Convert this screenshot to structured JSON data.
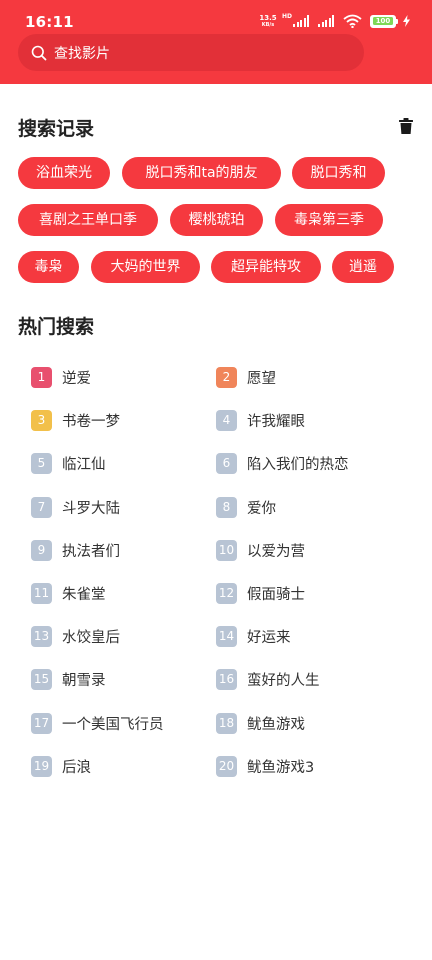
{
  "status_bar": {
    "time": "16:11",
    "net_speed_value": "13.5",
    "net_speed_unit": "KB/s",
    "sim1_tag": "HD",
    "battery": "100"
  },
  "search": {
    "placeholder": "查找影片"
  },
  "history": {
    "title": "搜索记录",
    "items": [
      "浴血荣光",
      "脱口秀和ta的朋友",
      "脱口秀和",
      "喜剧之王单口季",
      "樱桃琥珀",
      "毒枭第三季",
      "毒枭",
      "大妈的世界",
      "超异能特攻",
      "逍遥"
    ]
  },
  "hot": {
    "title": "热门搜索",
    "items": [
      {
        "rank": "1",
        "label": "逆爱"
      },
      {
        "rank": "2",
        "label": "愿望"
      },
      {
        "rank": "3",
        "label": "书卷一梦"
      },
      {
        "rank": "4",
        "label": "许我耀眼"
      },
      {
        "rank": "5",
        "label": "临江仙"
      },
      {
        "rank": "6",
        "label": "陷入我们的热恋"
      },
      {
        "rank": "7",
        "label": "斗罗大陆"
      },
      {
        "rank": "8",
        "label": "爱你"
      },
      {
        "rank": "9",
        "label": "执法者们"
      },
      {
        "rank": "10",
        "label": "以爱为营"
      },
      {
        "rank": "11",
        "label": "朱雀堂"
      },
      {
        "rank": "12",
        "label": "假面骑士"
      },
      {
        "rank": "13",
        "label": "水饺皇后"
      },
      {
        "rank": "14",
        "label": "好运来"
      },
      {
        "rank": "15",
        "label": "朝雪录"
      },
      {
        "rank": "16",
        "label": "蛮好的人生"
      },
      {
        "rank": "17",
        "label": "一个美国飞行员"
      },
      {
        "rank": "18",
        "label": "鱿鱼游戏"
      },
      {
        "rank": "19",
        "label": "后浪"
      },
      {
        "rank": "20",
        "label": "鱿鱼游戏3"
      }
    ]
  },
  "colors": {
    "accent": "#f5393f",
    "rank_1": "#e8506e",
    "rank_2": "#f0855a",
    "rank_3": "#f2c04a",
    "rank_default": "#b8c4d4"
  }
}
